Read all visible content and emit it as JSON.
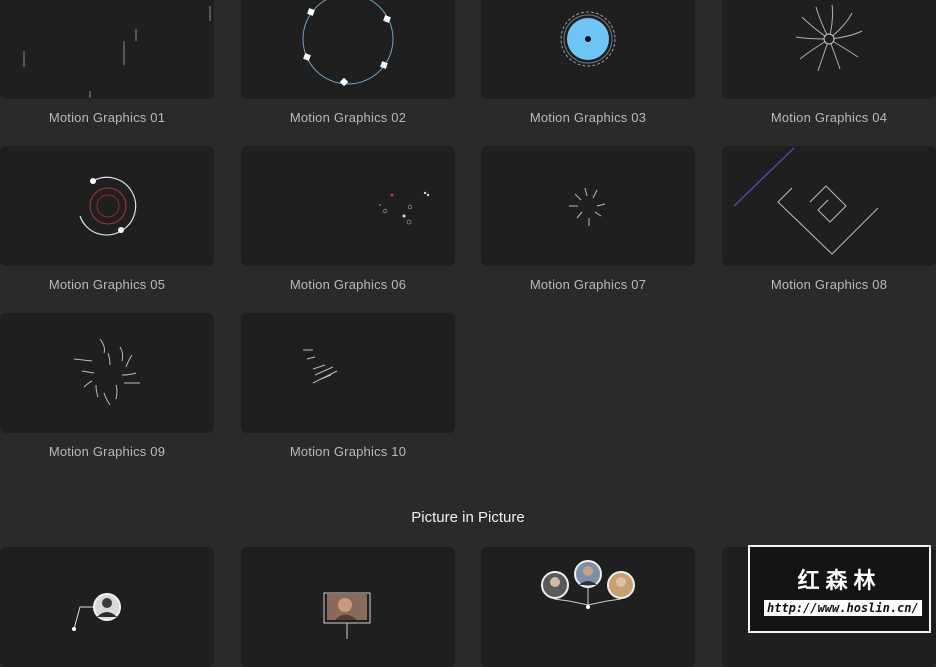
{
  "gallery": {
    "tiles": [
      {
        "label": "Motion Graphics 01"
      },
      {
        "label": "Motion Graphics 02"
      },
      {
        "label": "Motion Graphics 03"
      },
      {
        "label": "Motion Graphics 04"
      },
      {
        "label": "Motion Graphics 05"
      },
      {
        "label": "Motion Graphics 06"
      },
      {
        "label": "Motion Graphics 07"
      },
      {
        "label": "Motion Graphics 08"
      },
      {
        "label": "Motion Graphics 09"
      },
      {
        "label": "Motion Graphics 10"
      }
    ]
  },
  "pip_section": {
    "title": "Picture in Picture"
  },
  "watermark": {
    "title": "红森林",
    "url": "http://www.hoslin.cn/"
  },
  "colors": {
    "background": "#2a2a2b",
    "tile": "#1f1f20",
    "accent_blue": "#6cc5f5",
    "accent_red": "#b3323a",
    "accent_purple": "#5b4fd0"
  }
}
